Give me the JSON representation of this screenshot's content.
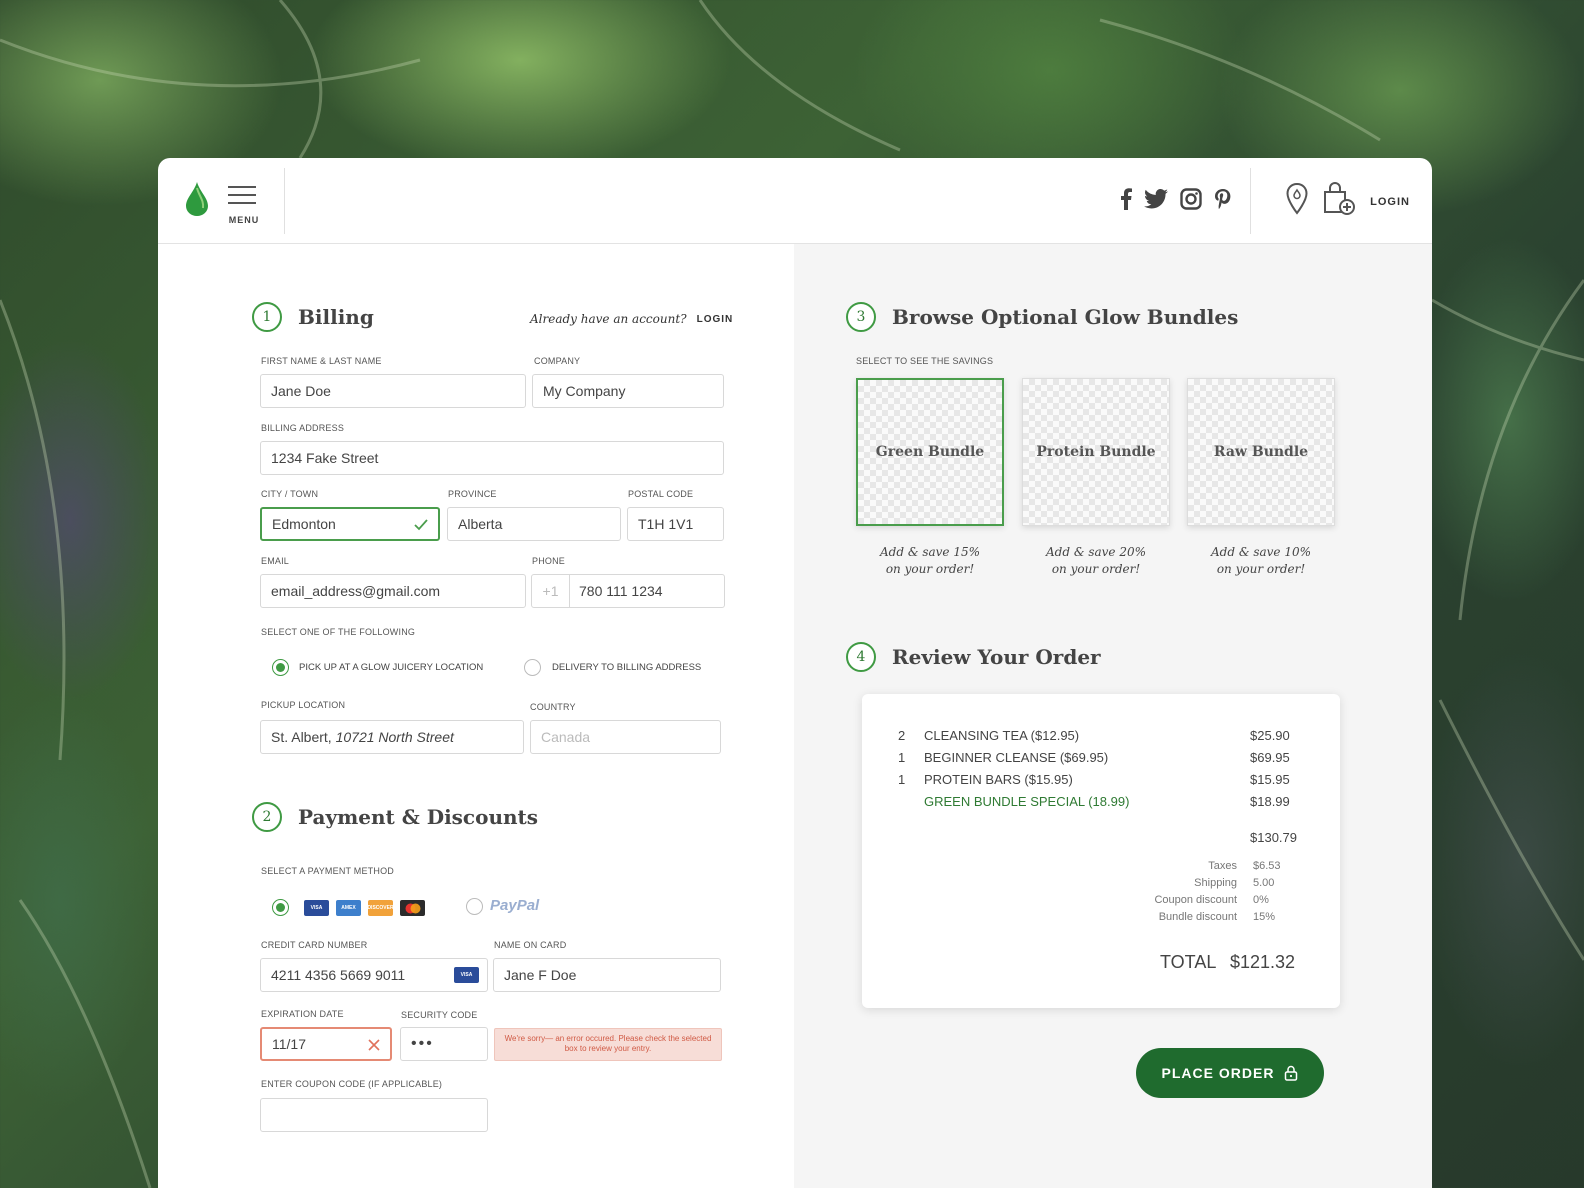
{
  "header": {
    "menu_label": "MENU",
    "login_label": "LOGIN",
    "social": [
      "facebook-icon",
      "twitter-icon",
      "instagram-icon",
      "pinterest-icon"
    ]
  },
  "billing": {
    "step": "1",
    "title": "Billing",
    "account_prompt": "Already have an account?",
    "login_link": "LOGIN",
    "name_label": "FIRST NAME & LAST NAME",
    "name_value": "Jane Doe",
    "company_label": "COMPANY",
    "company_value": "My Company",
    "address_label": "BILLING ADDRESS",
    "address_value": "1234 Fake Street",
    "city_label": "CITY / TOWN",
    "city_value": "Edmonton",
    "province_label": "PROVINCE",
    "province_value": "Alberta",
    "postal_label": "POSTAL CODE",
    "postal_value": "T1H 1V1",
    "email_label": "EMAIL",
    "email_value": "email_address@gmail.com",
    "phone_label": "PHONE",
    "phone_prefix": "+1",
    "phone_value": "780 111 1234",
    "select_label": "SELECT ONE OF THE FOLLOWING",
    "option_pickup": "PICK UP AT A GLOW JUICERY LOCATION",
    "option_delivery": "DELIVERY TO BILLING ADDRESS",
    "pickup_label": "PICKUP LOCATION",
    "pickup_city": "St. Albert,",
    "pickup_street": "10721 North Street",
    "country_label": "COUNTRY",
    "country_placeholder": "Canada"
  },
  "payment": {
    "step": "2",
    "title": "Payment & Discounts",
    "method_label": "SELECT A PAYMENT METHOD",
    "paypal_label": "PayPal",
    "card_logos": [
      "VISA",
      "AMEX",
      "DISCOVER",
      "MC"
    ],
    "cc_label": "CREDIT CARD NUMBER",
    "cc_value": "4211 4356 5669 9011",
    "cc_badge": "VISA",
    "name_label": "NAME ON CARD",
    "name_value": "Jane F Doe",
    "exp_label": "EXPIRATION DATE",
    "exp_value": "11/17",
    "sec_label": "SECURITY CODE",
    "sec_value": "•••",
    "error_msg": "We're sorry— an error occured. Please check the selected box to review your entry.",
    "coupon_label": "ENTER COUPON CODE (IF APPLICABLE)",
    "coupon_value": ""
  },
  "bundles": {
    "step": "3",
    "title": "Browse Optional Glow Bundles",
    "subtitle": "SELECT TO SEE THE SAVINGS",
    "items": [
      {
        "name": "Green Bundle",
        "save1": "Add & save 15%",
        "save2": "on your order!"
      },
      {
        "name": "Protein Bundle",
        "save1": "Add & save 20%",
        "save2": "on your order!"
      },
      {
        "name": "Raw Bundle",
        "save1": "Add & save 10%",
        "save2": "on your order!"
      }
    ]
  },
  "review": {
    "step": "4",
    "title": "Review Your Order",
    "lines": [
      {
        "qty": "2",
        "item": "CLEANSING TEA  ($12.95)",
        "price": "$25.90"
      },
      {
        "qty": "1",
        "item": "BEGINNER CLEANSE  ($69.95)",
        "price": "$69.95"
      },
      {
        "qty": "1",
        "item": "PROTEIN BARS  ($15.95)",
        "price": "$15.95"
      },
      {
        "qty": "",
        "item": "GREEN BUNDLE SPECIAL  (18.99)",
        "price": "$18.99"
      }
    ],
    "subtotal": "$130.79",
    "summary": [
      {
        "label": "Taxes",
        "value": "$6.53"
      },
      {
        "label": "Shipping",
        "value": "5.00"
      },
      {
        "label": "Coupon discount",
        "value": "0%"
      },
      {
        "label": "Bundle discount",
        "value": "15%"
      }
    ],
    "total_label": "TOTAL",
    "total_value": "$121.32",
    "place_order": "PLACE ORDER"
  },
  "colors": {
    "brand_green": "#1f6b2e",
    "accent_green": "#3f9a43",
    "error": "#e58a74"
  }
}
